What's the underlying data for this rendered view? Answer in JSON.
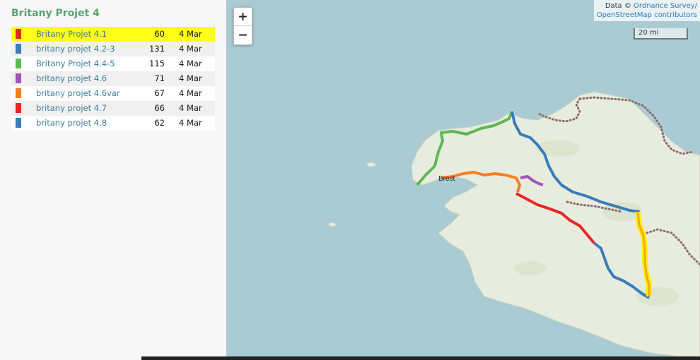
{
  "title": "Britany Projet 4",
  "routes": [
    {
      "name": "Britany Projet 4.1",
      "distance": "60",
      "date": "4 Mar",
      "color": "#e82624",
      "selected": true
    },
    {
      "name": "britany projet 4.2-3",
      "distance": "131",
      "date": "4 Mar",
      "color": "#3a7dbb"
    },
    {
      "name": "Britany Projet 4.4-5",
      "distance": "115",
      "date": "4 Mar",
      "color": "#5db855"
    },
    {
      "name": "britany projet 4.6",
      "distance": "71",
      "date": "4 Mar",
      "color": "#9e56b5"
    },
    {
      "name": "britany projet 4.6var",
      "distance": "67",
      "date": "4 Mar",
      "color": "#f57e1f"
    },
    {
      "name": "britany projet 4.7",
      "distance": "66",
      "date": "4 Mar",
      "color": "#e82624"
    },
    {
      "name": "britany projet 4.8",
      "distance": "62",
      "date": "4 Mar",
      "color": "#3a7dbb"
    }
  ],
  "map": {
    "zoom_in": "+",
    "zoom_out": "−",
    "attribution_prefix": "Data © ",
    "attribution_link1": "Ordnance Survey/",
    "attribution_link2": "OpenStreetMap contributors",
    "scale_label": "20 mi",
    "place_label": "Brest",
    "sea_color": "#aacbd3",
    "land_color": "#e8ecdf"
  }
}
